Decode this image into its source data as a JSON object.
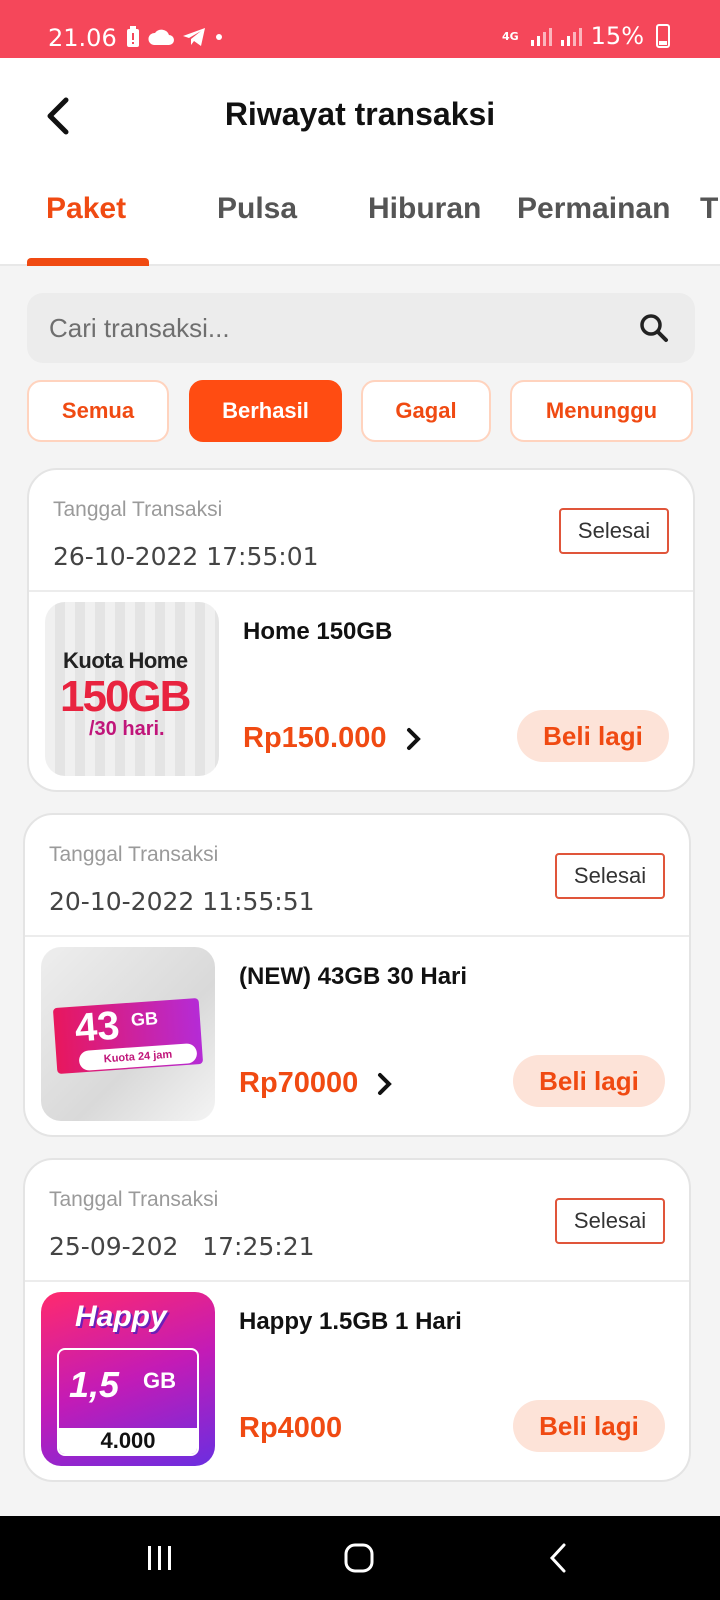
{
  "status_bar": {
    "time": "21.06",
    "network": "4G",
    "battery": "15%"
  },
  "header": {
    "title": "Riwayat transaksi"
  },
  "tabs": [
    {
      "label": "Paket",
      "active": true
    },
    {
      "label": "Pulsa",
      "active": false
    },
    {
      "label": "Hiburan",
      "active": false
    },
    {
      "label": "Permainan",
      "active": false
    },
    {
      "label": "T",
      "active": false
    }
  ],
  "search": {
    "placeholder": "Cari transaksi..."
  },
  "filters": [
    {
      "label": "Semua",
      "active": false
    },
    {
      "label": "Berhasil",
      "active": true
    },
    {
      "label": "Gagal",
      "active": false
    },
    {
      "label": "Menunggu",
      "active": false
    }
  ],
  "transactions": [
    {
      "date_label": "Tanggal Transaksi",
      "date": "26-10-2022 17:55:01",
      "status": "Selesai",
      "product": "Home 150GB",
      "price": "Rp150.000",
      "action": "Beli lagi",
      "image_text": [
        "Kuota Home",
        "150GB",
        "/30 hari."
      ]
    },
    {
      "date_label": "Tanggal Transaksi",
      "date": "20-10-2022 11:55:51",
      "status": "Selesai",
      "product": "(NEW) 43GB 30 Hari",
      "price": "Rp70000",
      "action": "Beli lagi",
      "image_text": [
        "43",
        "GB",
        "Kuota 24 jam"
      ]
    },
    {
      "date_label": "Tanggal Transaksi",
      "date": "25-09-202   17:25:21",
      "status": "Selesai",
      "product": "Happy 1.5GB 1 Hari",
      "price": "Rp4000",
      "action": "Beli lagi",
      "image_text": [
        "Happy",
        "1,5",
        "GB",
        "4.000"
      ]
    }
  ],
  "colors": {
    "accent": "#f04a12",
    "status_bar": "#f5475a",
    "buy_again_bg": "#fde3d8"
  }
}
